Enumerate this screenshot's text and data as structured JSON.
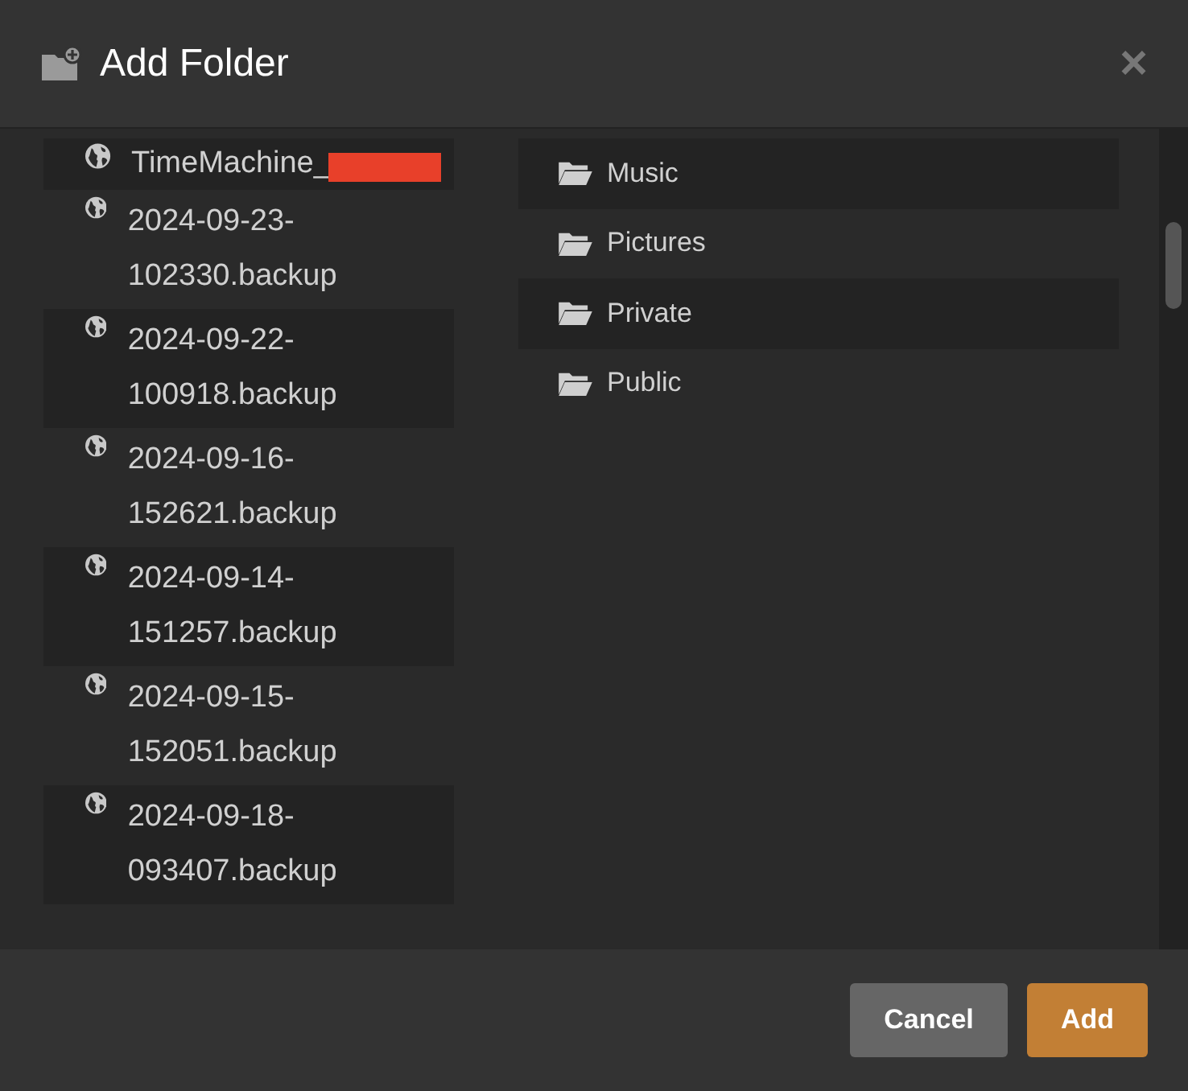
{
  "dialog": {
    "title": "Add Folder",
    "close": "×"
  },
  "left_list": [
    {
      "name": "TimeMachine_",
      "redacted": true
    },
    {
      "name": "2024-09-23-102330.backup",
      "redacted": false
    },
    {
      "name": "2024-09-22-100918.backup",
      "redacted": false
    },
    {
      "name": "2024-09-16-152621.backup",
      "redacted": false
    },
    {
      "name": "2024-09-14-151257.backup",
      "redacted": false
    },
    {
      "name": "2024-09-15-152051.backup",
      "redacted": false
    },
    {
      "name": "2024-09-18-093407.backup",
      "redacted": false
    }
  ],
  "right_list": [
    "Music",
    "Pictures",
    "Private",
    "Public"
  ],
  "buttons": [
    {
      "label": "Cancel",
      "kind": "secondary"
    },
    {
      "label": "Add",
      "kind": "primary"
    }
  ]
}
